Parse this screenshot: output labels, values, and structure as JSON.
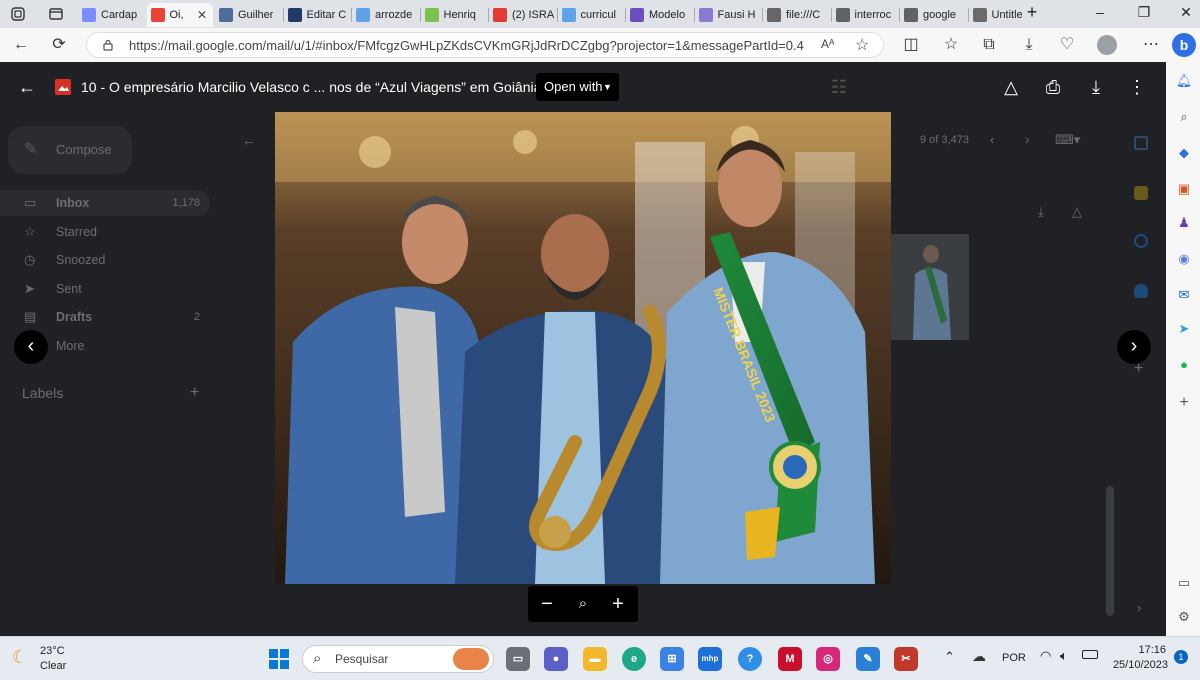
{
  "browser": {
    "tabs": [
      {
        "label": "Cardap",
        "color": "#7b8cff"
      },
      {
        "label": "Oi,",
        "color": "#ea4335",
        "active": true
      },
      {
        "label": "Guilher",
        "color": "#4f6c9a"
      },
      {
        "label": "Editar C",
        "color": "#1f3a66"
      },
      {
        "label": "arrozde",
        "color": "#5ea3e8"
      },
      {
        "label": "Henriq",
        "color": "#7cc24c"
      },
      {
        "label": "(2) ISRA",
        "color": "#e53935"
      },
      {
        "label": "curricul",
        "color": "#5ea3e8"
      },
      {
        "label": "Modelo",
        "color": "#6b4fbf"
      },
      {
        "label": "Fausi H",
        "color": "#8a7bd1"
      },
      {
        "label": "file:///C",
        "color": "#666666"
      },
      {
        "label": "interroc",
        "color": "#5f6368"
      },
      {
        "label": "google",
        "color": "#5f6368"
      },
      {
        "label": "Untitle",
        "color": "#6a6a6a"
      }
    ],
    "new_tab": "+",
    "url": "https://mail.google.com/mail/u/1/#inbox/FMfcgzGwHLpZKdsCVKmGRjJdRrDCZgbg?projector=1&messagePartId=0.4"
  },
  "gmail": {
    "compose": "Compose",
    "nav": [
      {
        "label": "Inbox",
        "count": "1,178"
      },
      {
        "label": "Starred",
        "count": ""
      },
      {
        "label": "Snoozed",
        "count": ""
      },
      {
        "label": "Sent",
        "count": ""
      },
      {
        "label": "Drafts",
        "count": "2"
      },
      {
        "label": "More",
        "count": ""
      }
    ],
    "labels_heading": "Labels",
    "pager": "9 of 3,473"
  },
  "viewer": {
    "file_title": "10 - O empresário Marcilio Velasco c ... nos de “Azul Viagens” em Goiânia.png",
    "open_with": "Open with",
    "sash_text": "MISTER BRASIL 2023"
  },
  "taskbar": {
    "weather_temp": "23°C",
    "weather_desc": "Clear",
    "search_placeholder": "Pesquisar",
    "language": "POR",
    "time": "17:16",
    "date": "25/10/2023",
    "notification_count": "1"
  },
  "colors": {
    "gmail_bg": "#202124",
    "browser_chrome": "#f7f7f7",
    "tab_strip": "#dfe3e8",
    "taskbar": "#e6ebf2",
    "suit_blue": "#7fa6cf",
    "sash_green": "#1f8a3a"
  }
}
